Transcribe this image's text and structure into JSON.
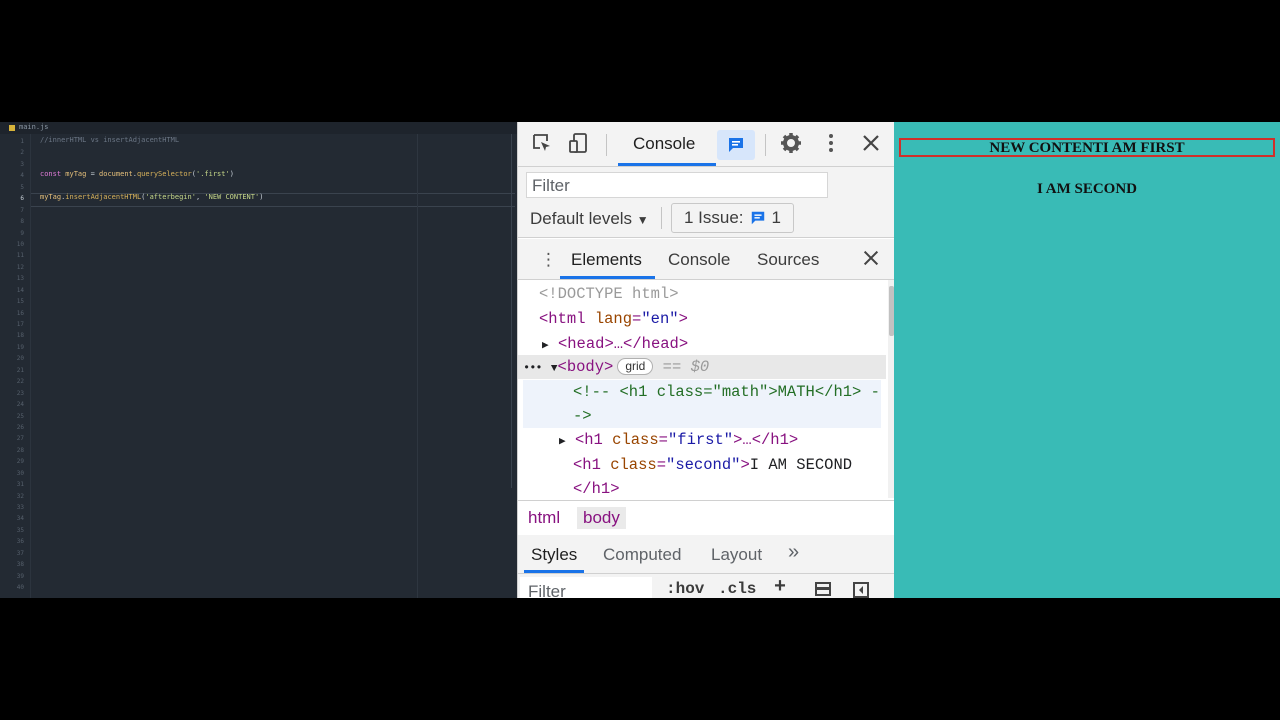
{
  "editor": {
    "filename": "main.js",
    "current_line": 6,
    "line_numbers": [
      "1",
      "2",
      "3",
      "4",
      "5",
      "6",
      "7",
      "8",
      "9",
      "10",
      "11",
      "12",
      "13",
      "14",
      "15",
      "16",
      "17",
      "18",
      "19",
      "20",
      "21",
      "22",
      "23",
      "24",
      "25",
      "26",
      "27",
      "28",
      "29",
      "30",
      "31",
      "32",
      "33",
      "34",
      "35",
      "36",
      "37",
      "38",
      "39",
      "40"
    ],
    "code": {
      "l1_comment": "//innerHTML vs insertAdjacentHTML",
      "l4_kw": "const",
      "l4_var": " myTag",
      "l4_eq": " = ",
      "l4_obj": "document",
      "l4_dot": ".",
      "l4_fn": "querySelector",
      "l4_open": "(",
      "l4_str": "'.first'",
      "l4_close": ")",
      "l6_var": "myTag",
      "l6_dot": ".",
      "l6_fn": "insertAdjacentHTML",
      "l6_open": "(",
      "l6_str1": "'afterbegin'",
      "l6_comma": ", ",
      "l6_str2": "'NEW CONTENT'",
      "l6_close": ")"
    }
  },
  "devtools": {
    "toolbar": {
      "inspect_icon": "inspect-element-icon",
      "device_icon": "device-toolbar-icon",
      "console_tab": "Console",
      "messages_icon": "message-icon",
      "settings_icon": "gear-icon",
      "more_icon": "kebab-icon",
      "close_icon": "close-icon"
    },
    "console": {
      "filter_placeholder": "Filter",
      "levels": "Default levels",
      "issues_label": "1 Issue:",
      "issues_count": "1"
    },
    "drawer_tabs": [
      "Elements",
      "Console",
      "Sources"
    ],
    "dom": {
      "doctype": "<!DOCTYPE html>",
      "html_open": "<html",
      "html_attr": " lang",
      "html_eq": "=",
      "html_val": "\"en\"",
      "html_close": ">",
      "head": "<head>…</head>",
      "body": "<body>",
      "grid_badge": "grid",
      "eq_dollar": "== $0",
      "comment_line1": "<!-- <h1 class=\"math\">MATH</h1> -",
      "comment_line2": "->",
      "h1_first_open": "<h1",
      "h1_first_attr": " class",
      "h1_first_eq": "=",
      "h1_first_val": "\"first\"",
      "h1_first_rest": ">…</h1>",
      "h1_second_open": "<h1",
      "h1_second_attr": " class",
      "h1_second_eq": "=",
      "h1_second_val": "\"second\"",
      "h1_second_gt": ">",
      "h1_second_text": "I AM SECOND",
      "h1_second_close": "</h1>"
    },
    "breadcrumbs": [
      "html",
      "body"
    ],
    "styles_tabs": [
      "Styles",
      "Computed",
      "Layout"
    ],
    "styles_more": "»",
    "styles_filter_placeholder": "Filter",
    "hov": ":hov",
    "cls": ".cls",
    "plus": "+"
  },
  "preview": {
    "first_heading": "NEW CONTENTI AM FIRST",
    "second_heading": "I AM SECOND"
  },
  "colors": {
    "preview_bg": "#39bbb6",
    "first_border": "#d0302a",
    "accent": "#1a73e8",
    "editor_bg": "#232a33"
  }
}
